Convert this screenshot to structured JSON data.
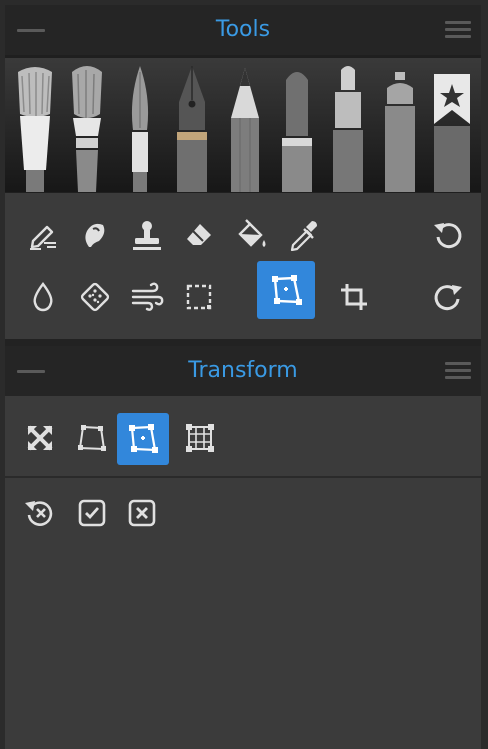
{
  "tools_panel": {
    "title": "Tools",
    "brushes": [
      "oil-brush",
      "paint-brush",
      "fine-brush",
      "ink-pen",
      "pencil",
      "felt-pen",
      "marker",
      "airbrush",
      "bookmark-brush"
    ],
    "tools_row1": [
      "eraser-pencil-icon",
      "smudge-icon",
      "stamp-icon",
      "eraser-icon",
      "fill-bucket-icon",
      "eyedropper-icon",
      "undo-icon"
    ],
    "tools_row2": [
      "water-drop-icon",
      "texture-icon",
      "blend-wind-icon",
      "selection-icon",
      "transform-icon",
      "crop-icon",
      "redo-icon"
    ],
    "active_tool": "transform-icon"
  },
  "transform_panel": {
    "title": "Transform",
    "modes": [
      "free-transform-icon",
      "distort-icon",
      "perspective-icon",
      "warp-mesh-icon"
    ],
    "active_mode": "perspective-icon",
    "actions": [
      "reset-icon",
      "apply-icon",
      "cancel-icon"
    ]
  },
  "colors": {
    "accent": "#3a9ae4",
    "active_bg": "#3287db",
    "panel_bg": "#3b3b3b",
    "header_bg": "#252525"
  }
}
